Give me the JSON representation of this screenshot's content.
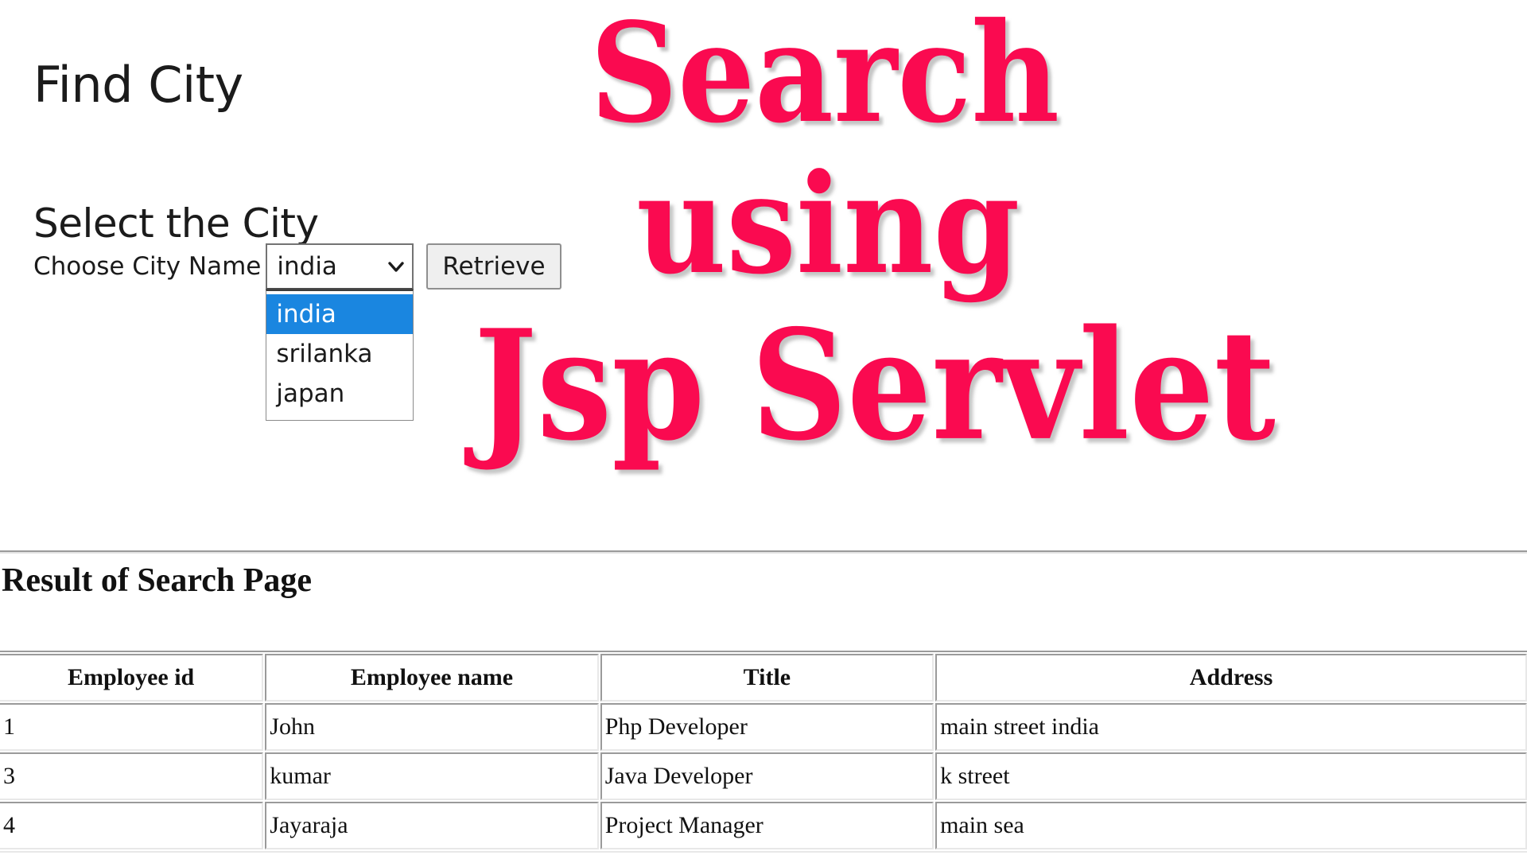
{
  "page": {
    "heading_find_city": "Find City",
    "heading_select_city": "Select the City",
    "hr": "horizontal-rule",
    "result_heading": "Result of Search Page"
  },
  "form": {
    "choose_label": "Choose City Name",
    "select": {
      "selected_value": "india",
      "expanded": true,
      "chevron_icon": "chevron-down-icon",
      "options": [
        {
          "label": "india",
          "selected": true
        },
        {
          "label": "srilanka",
          "selected": false
        },
        {
          "label": "japan",
          "selected": false
        }
      ]
    },
    "retrieve_button": "Retrieve"
  },
  "table": {
    "headers": [
      "Employee id",
      "Employee name",
      "Title",
      "Address"
    ],
    "rows": [
      {
        "id": "1",
        "name": "John",
        "title": "Php Developer",
        "address": "main street india"
      },
      {
        "id": "3",
        "name": "kumar",
        "title": "Java Developer",
        "address": "k street"
      },
      {
        "id": "4",
        "name": "Jayaraja",
        "title": "Project Manager",
        "address": "main sea"
      }
    ]
  },
  "overlay": {
    "line1": "Search",
    "line2": "using",
    "line3": "Jsp Servlet",
    "color": "#fa0a50",
    "shadow_color": "#969696"
  },
  "colors": {
    "highlight_blue": "#1a86e0",
    "text": "#1b1b1b",
    "button_face": "#efefef",
    "border_grey": "#8f8f8f",
    "background": "#ffffff"
  }
}
